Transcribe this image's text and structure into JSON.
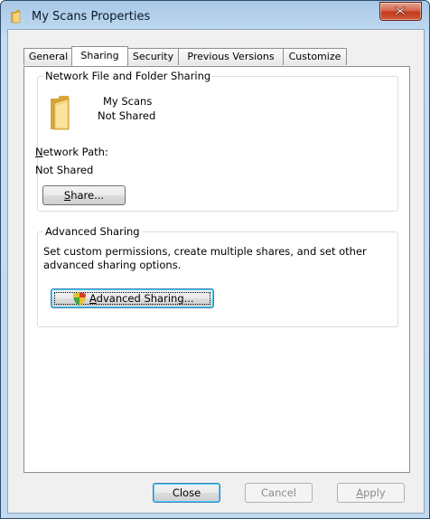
{
  "window": {
    "title": "My Scans Properties"
  },
  "tabs": [
    {
      "label": "General"
    },
    {
      "label": "Sharing"
    },
    {
      "label": "Security"
    },
    {
      "label": "Previous Versions"
    },
    {
      "label": "Customize"
    }
  ],
  "network_sharing": {
    "group_title": "Network File and Folder Sharing",
    "folder_name": "My Scans",
    "folder_status": "Not Shared",
    "path_label": "Network Path:",
    "path_label_access_key": "N",
    "path_value": "Not Shared",
    "share_button": "Share...",
    "share_access_key": "S"
  },
  "advanced_sharing": {
    "group_title": "Advanced Sharing",
    "description_line1": "Set custom permissions, create multiple shares, and set other",
    "description_line2": "advanced sharing options.",
    "button": "Advanced Sharing...",
    "button_access_key": "A",
    "shield_icon": "uac-shield-icon"
  },
  "footer": {
    "close": "Close",
    "cancel": "Cancel",
    "apply": "Apply",
    "apply_access_key": "A"
  },
  "colors": {
    "accent": "#3c7fb1",
    "folder": "#f1c75a",
    "close_button": "#c0391b"
  }
}
